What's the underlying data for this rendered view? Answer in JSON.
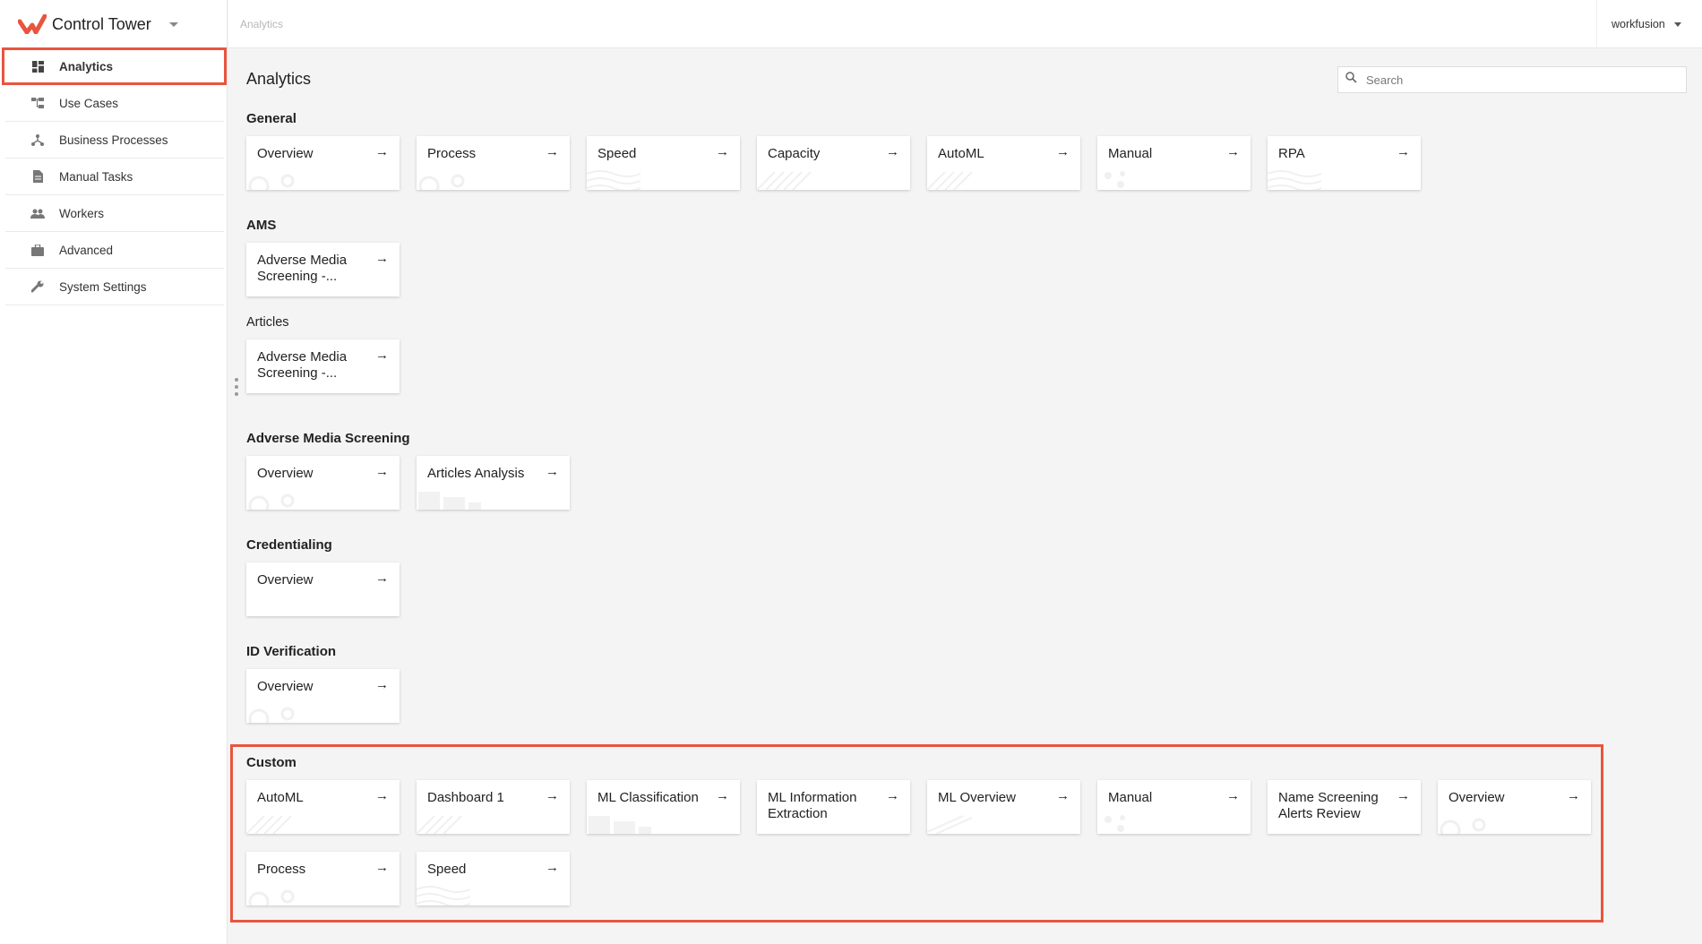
{
  "app": {
    "title": "Control Tower",
    "brand_color": "#e8553e"
  },
  "breadcrumb": "Analytics",
  "user": {
    "name": "workfusion"
  },
  "sidebar": {
    "items": [
      {
        "label": "Analytics",
        "icon": "dashboard-icon"
      },
      {
        "label": "Use Cases",
        "icon": "flow-icon"
      },
      {
        "label": "Business Processes",
        "icon": "process-icon"
      },
      {
        "label": "Manual Tasks",
        "icon": "document-icon"
      },
      {
        "label": "Workers",
        "icon": "people-icon"
      },
      {
        "label": "Advanced",
        "icon": "briefcase-icon"
      },
      {
        "label": "System Settings",
        "icon": "wrench-icon"
      }
    ]
  },
  "main": {
    "title": "Analytics",
    "search_placeholder": "Search",
    "sections": [
      {
        "title": "General",
        "cards": [
          "Overview",
          "Process",
          "Speed",
          "Capacity",
          "AutoML",
          "Manual",
          "RPA"
        ]
      },
      {
        "title": "AMS",
        "cards": [
          "Adverse Media Screening -..."
        ]
      },
      {
        "title": "Articles",
        "cards": [
          "Adverse Media Screening -..."
        ]
      },
      {
        "title": "Adverse Media Screening",
        "cards": [
          "Overview",
          "Articles Analysis"
        ]
      },
      {
        "title": "Credentialing",
        "cards": [
          "Overview"
        ]
      },
      {
        "title": "ID Verification",
        "cards": [
          "Overview"
        ]
      },
      {
        "title": "Custom",
        "cards": [
          "AutoML",
          "Dashboard 1",
          "ML Classification",
          "ML Information Extraction",
          "ML Overview",
          "Manual",
          "Name Screening Alerts Review",
          "Overview",
          "Process",
          "Speed"
        ]
      }
    ]
  }
}
